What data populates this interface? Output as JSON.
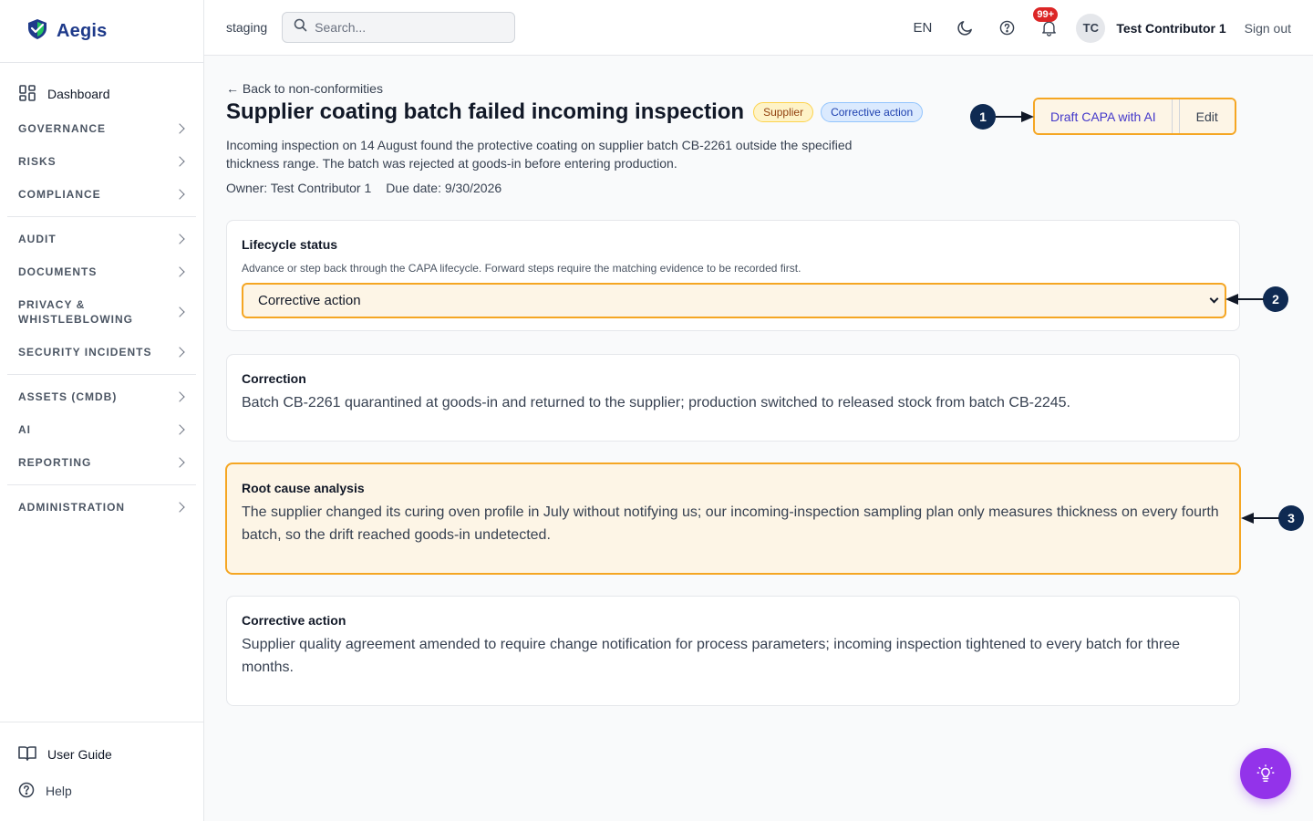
{
  "app": {
    "name": "Aegis",
    "environment": "staging"
  },
  "sidebar": {
    "dashboard": "Dashboard",
    "sections": [
      "GOVERNANCE",
      "RISKS",
      "COMPLIANCE",
      "AUDIT",
      "DOCUMENTS",
      "PRIVACY & WHISTLEBLOWING",
      "SECURITY INCIDENTS",
      "ASSETS (CMDB)",
      "AI",
      "REPORTING",
      "ADMINISTRATION"
    ],
    "user_guide": "User Guide",
    "help": "Help"
  },
  "header": {
    "search_placeholder": "Search...",
    "language": "EN",
    "notifications_badge": "99+",
    "avatar_initials": "TC",
    "user_name": "Test Contributor 1",
    "sign_out": "Sign out"
  },
  "page": {
    "back_link": "← Back to non-conformities",
    "title": "Supplier coating batch failed incoming inspection",
    "tags": [
      "Supplier",
      "Corrective action"
    ],
    "description": "Incoming inspection on 14 August found the protective coating on supplier batch CB-2261 outside the specified thickness range. The batch was rejected at goods-in before entering production.",
    "owner": "Owner: Test Contributor 1",
    "due_date": "Due date: 9/30/2026",
    "actions": {
      "draft_capa": "Draft CAPA with AI",
      "edit": "Edit"
    }
  },
  "lifecycle": {
    "title": "Lifecycle status",
    "hint": "Advance or step back through the CAPA lifecycle. Forward steps require the matching evidence to be recorded first.",
    "selected": "Corrective action"
  },
  "correction": {
    "title": "Correction",
    "body": "Batch CB-2261 quarantined at goods-in and returned to the supplier; production switched to released stock from batch CB-2245."
  },
  "root_cause": {
    "title": "Root cause analysis",
    "body": "The supplier changed its curing oven profile in July without notifying us; our incoming-inspection sampling plan only measures thickness on every fourth batch, so the drift reached goods-in undetected."
  },
  "corrective_action": {
    "title": "Corrective action",
    "body": "Supplier quality agreement amended to require change notification for process parameters; incoming inspection tightened to every batch for three months."
  },
  "annotations": [
    "1",
    "2",
    "3"
  ],
  "colors": {
    "highlight_border": "#f5a623",
    "highlight_fill": "#fdf5e6",
    "marker": "#0f2a52",
    "fab": "#9333ea"
  }
}
